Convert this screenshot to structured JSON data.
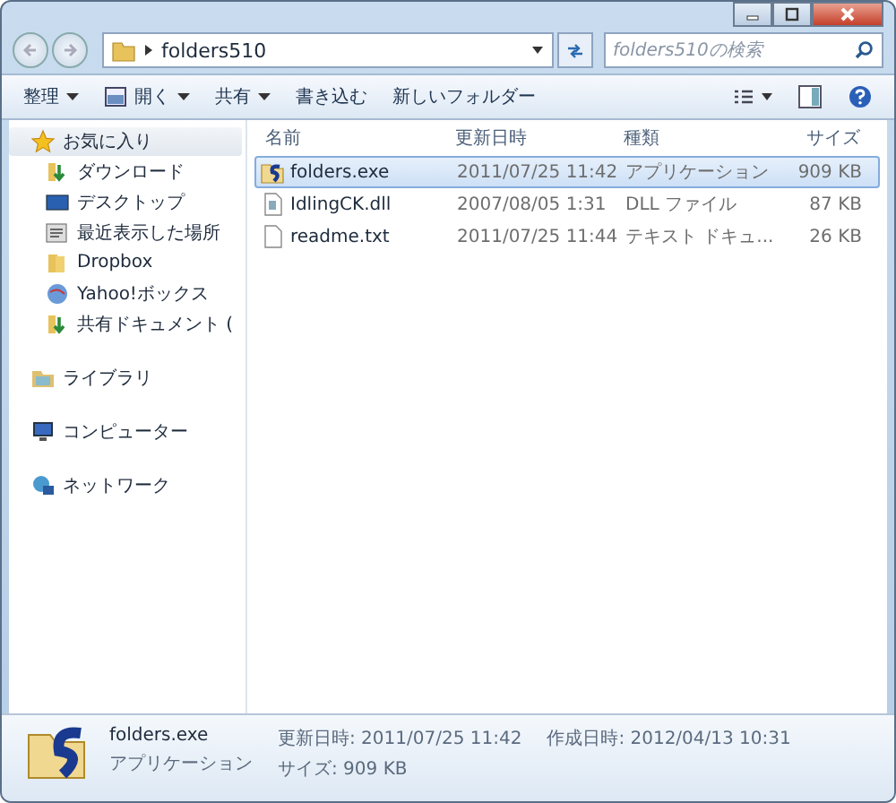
{
  "address": {
    "path": "folders510",
    "search_placeholder": "folders510の検索"
  },
  "toolbar": [
    {
      "label": "整理",
      "dropdown": true,
      "kind": "plain"
    },
    {
      "label": "開く",
      "dropdown": true,
      "kind": "open"
    },
    {
      "label": "共有",
      "dropdown": true,
      "kind": "plain"
    },
    {
      "label": "書き込む",
      "dropdown": false,
      "kind": "plain"
    },
    {
      "label": "新しいフォルダー",
      "dropdown": false,
      "kind": "plain"
    }
  ],
  "sidebar": [
    {
      "label": "お気に入り",
      "kind": "star",
      "selected": true,
      "children": [
        {
          "label": "ダウンロード",
          "kind": "download",
          "selected": false
        },
        {
          "label": "デスクトップ",
          "kind": "desktop",
          "selected": false
        },
        {
          "label": "最近表示した場所",
          "kind": "recent",
          "selected": false
        },
        {
          "label": "Dropbox",
          "kind": "folder",
          "selected": false
        },
        {
          "label": "Yahoo!ボックス",
          "kind": "globe",
          "selected": false
        },
        {
          "label": "共有ドキュメント (",
          "kind": "download",
          "selected": false
        }
      ]
    },
    {
      "label": "ライブラリ",
      "kind": "library",
      "selected": false
    },
    {
      "label": "コンピューター",
      "kind": "computer",
      "selected": false
    },
    {
      "label": "ネットワーク",
      "kind": "network",
      "selected": false
    }
  ],
  "table": {
    "columns": [
      "名前",
      "更新日時",
      "種類",
      "サイズ"
    ],
    "rows": [
      {
        "name": "folders.exe",
        "modified": "2011/07/25 11:42",
        "type": "アプリケーション",
        "size": "909 KB",
        "kind": "exe",
        "selected": true
      },
      {
        "name": "IdlingCK.dll",
        "modified": "2007/08/05 1:31",
        "type": "DLL ファイル",
        "size": "87 KB",
        "kind": "dll",
        "selected": false
      },
      {
        "name": "readme.txt",
        "modified": "2011/07/25 11:44",
        "type": "テキスト ドキュ...",
        "size": "26 KB",
        "kind": "txt",
        "selected": false
      }
    ]
  },
  "details": {
    "name": "folders.exe",
    "type": "アプリケーション",
    "modified": "更新日時: 2011/07/25 11:42",
    "size": "サイズ: 909 KB",
    "created": "作成日時: 2012/04/13 10:31"
  }
}
